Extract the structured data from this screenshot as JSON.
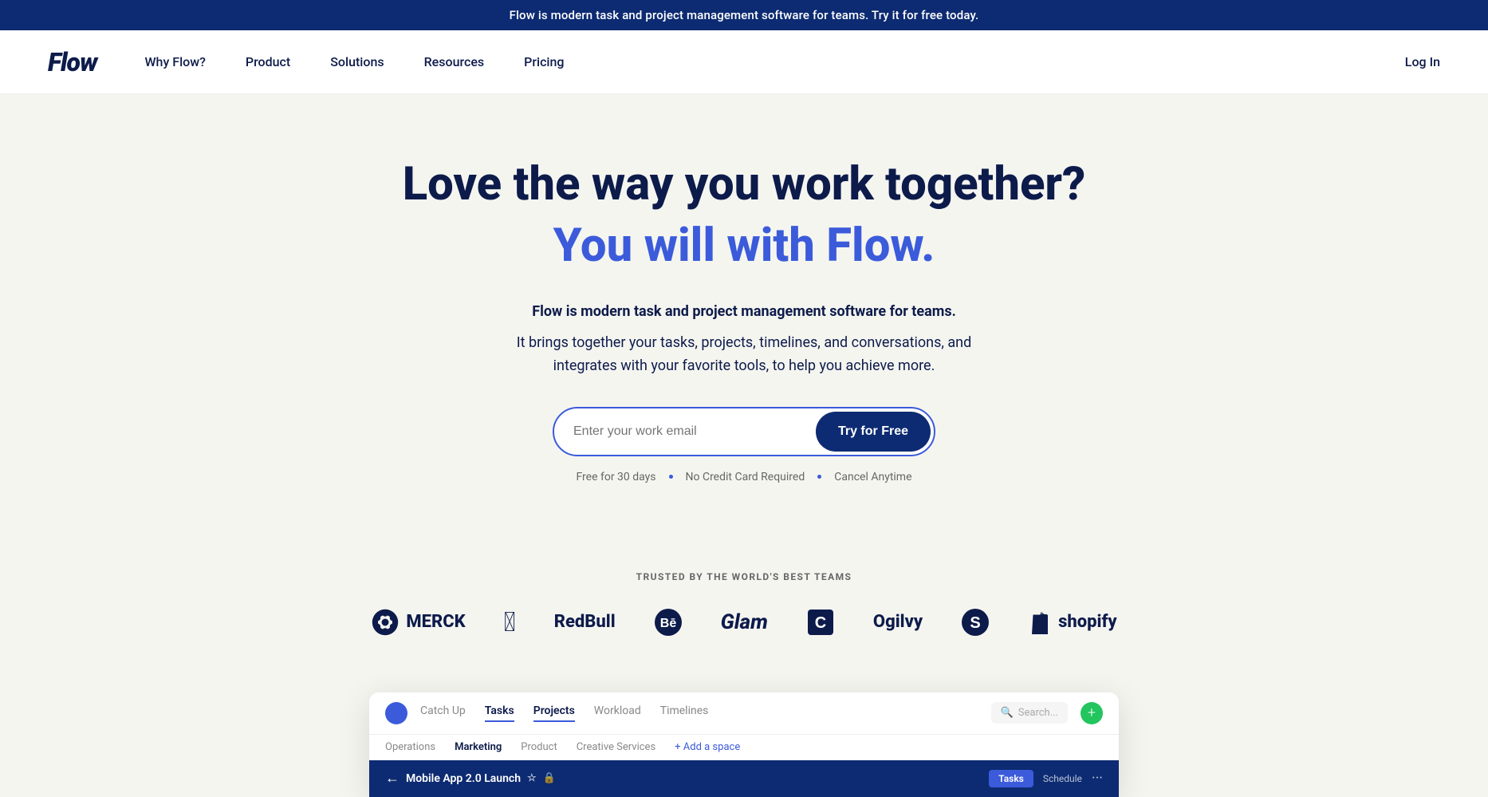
{
  "banner": {
    "text": "Flow is modern task and project management software for teams. Try it for free today."
  },
  "nav": {
    "logo": "Flow",
    "links": [
      {
        "label": "Why Flow?",
        "id": "why-flow"
      },
      {
        "label": "Product",
        "id": "product"
      },
      {
        "label": "Solutions",
        "id": "solutions"
      },
      {
        "label": "Resources",
        "id": "resources"
      },
      {
        "label": "Pricing",
        "id": "pricing"
      }
    ],
    "login": "Log In"
  },
  "hero": {
    "title_line1": "Love the way you work together?",
    "title_line2": "You will with Flow.",
    "subtitle_bold": "Flow is modern task and project management software for teams.",
    "subtitle_rest": "It brings together your tasks, projects, timelines, and conversations, and integrates with your favorite tools, to help you achieve more.",
    "email_placeholder": "Enter your work email",
    "cta_button": "Try for Free",
    "fine_print": [
      "Free for 30 days",
      "No Credit Card Required",
      "Cancel Anytime"
    ]
  },
  "trusted": {
    "label": "TRUSTED BY THE WORLD'S BEST TEAMS",
    "brands": [
      {
        "name": "MERCK",
        "type": "merck"
      },
      {
        "name": "",
        "type": "apple"
      },
      {
        "name": "RedBull",
        "type": "redbull"
      },
      {
        "name": "",
        "type": "behance"
      },
      {
        "name": "Glam",
        "type": "glam"
      },
      {
        "name": "",
        "type": "carhartt"
      },
      {
        "name": "Ogilvy",
        "type": "ogilvy"
      },
      {
        "name": "",
        "type": "sketchapp"
      },
      {
        "name": "shopify",
        "type": "shopify"
      }
    ]
  },
  "app_preview": {
    "tabs": [
      "Catch Up",
      "Tasks",
      "Projects",
      "Workload",
      "Timelines"
    ],
    "active_tab": "Projects",
    "subtabs": [
      "Operations",
      "Marketing",
      "Product",
      "Creative Services",
      "+ Add a space"
    ],
    "active_subtab": "Marketing",
    "search_placeholder": "Search...",
    "project_name": "Mobile App 2.0 Launch",
    "view_buttons": [
      "Tasks",
      "Schedule"
    ],
    "dots": "···"
  }
}
